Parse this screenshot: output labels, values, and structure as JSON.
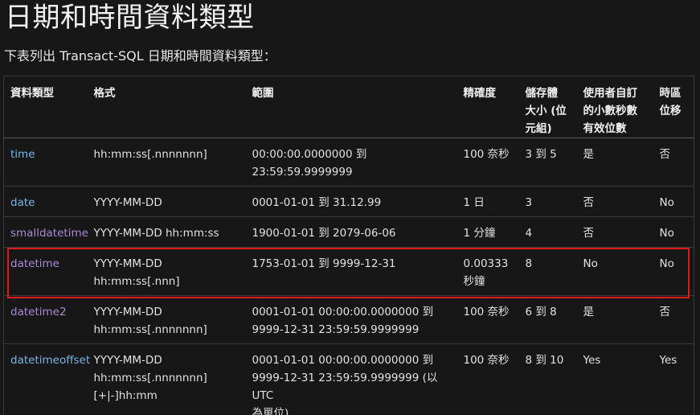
{
  "title": "日期和時間資料類型",
  "intro": "下表列出 Transact-SQL 日期和時間資料類型：",
  "table": {
    "headers": [
      [
        "資料類型"
      ],
      [
        "格式"
      ],
      [
        "範圍"
      ],
      [
        "精確度"
      ],
      [
        "儲存體",
        "大小 (位",
        "元組)"
      ],
      [
        "使用者自訂",
        "的小數秒數",
        "有效位數"
      ],
      [
        "時區",
        "位移"
      ]
    ],
    "rows": [
      {
        "type": "time",
        "format": [
          "hh:mm:ss[.nnnnnnn]"
        ],
        "range": [
          "00:00:00.0000000 到",
          "23:59:59.9999999"
        ],
        "accuracy": [
          "100 奈秒"
        ],
        "storage": "3 到 5",
        "fractional": "是",
        "offset": "否"
      },
      {
        "type": "date",
        "format": [
          "YYYY-MM-DD"
        ],
        "range": [
          "0001-01-01 到 31.12.99"
        ],
        "accuracy": [
          "1 日"
        ],
        "storage": "3",
        "fractional": "否",
        "offset": "No"
      },
      {
        "type": "smalldatetime",
        "format": [
          "YYYY-MM-DD hh:mm:ss"
        ],
        "range": [
          "1900-01-01 到 2079-06-06"
        ],
        "accuracy": [
          "1 分鐘"
        ],
        "storage": "4",
        "fractional": "否",
        "offset": "No"
      },
      {
        "type": "datetime",
        "format": [
          "YYYY-MM-DD",
          "hh:mm:ss[.nnn]"
        ],
        "range": [
          "1753-01-01 到 9999-12-31"
        ],
        "accuracy": [
          "0.00333",
          "秒鐘"
        ],
        "storage": "8",
        "fractional": "No",
        "offset": "No"
      },
      {
        "type": "datetime2",
        "format": [
          "YYYY-MM-DD",
          "hh:mm:ss[.nnnnnnn]"
        ],
        "range": [
          "0001-01-01 00:00:00.0000000 到",
          "9999-12-31 23:59:59.9999999"
        ],
        "accuracy": [
          "100 奈秒"
        ],
        "storage": "6 到 8",
        "fractional": "是",
        "offset": "否"
      },
      {
        "type": "datetimeoffset",
        "format": [
          "YYYY-MM-DD",
          "hh:mm:ss[.nnnnnnn]",
          "[+|-]hh:mm"
        ],
        "range": [
          "0001-01-01 00:00:00.0000000 到",
          "9999-12-31 23:59:59.9999999 (以 UTC",
          "為單位)"
        ],
        "accuracy": [
          "100 奈秒"
        ],
        "storage": "8 到 10",
        "fractional": "Yes",
        "offset": "Yes"
      }
    ]
  },
  "colors": {
    "background": "#171717",
    "link": "#75b6e7",
    "visited_link": "#a98bd8",
    "highlight": "#e01b1b"
  }
}
